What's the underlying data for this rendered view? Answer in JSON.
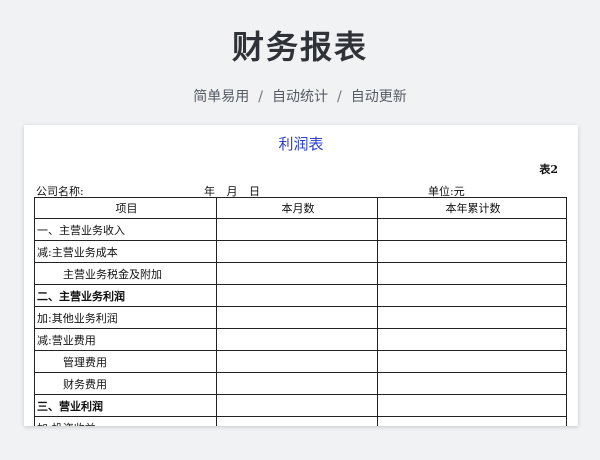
{
  "page": {
    "title": "财务报表",
    "tags": [
      "简单易用",
      "自动统计",
      "自动更新"
    ],
    "separator": "/"
  },
  "sheet": {
    "title": "利润表",
    "table_no": "表2",
    "company_label": "公司名称:",
    "date_label": "年 月 日",
    "unit_label": "单位:元",
    "headers": [
      "项目",
      "本月数",
      "本年累计数"
    ],
    "rows": [
      {
        "label": "一、主营业务收入",
        "bold": false,
        "indent": false
      },
      {
        "label": "减:主营业务成本",
        "bold": false,
        "indent": false
      },
      {
        "label": "主营业务税金及附加",
        "bold": false,
        "indent": true
      },
      {
        "label": "二、主营业务利润",
        "bold": true,
        "indent": false
      },
      {
        "label": "加:其他业务利润",
        "bold": false,
        "indent": false
      },
      {
        "label": "减:营业费用",
        "bold": false,
        "indent": false
      },
      {
        "label": "管理费用",
        "bold": false,
        "indent": true
      },
      {
        "label": "财务费用",
        "bold": false,
        "indent": true
      },
      {
        "label": "三、营业利润",
        "bold": true,
        "indent": false
      },
      {
        "label": "加:投资收益",
        "bold": false,
        "indent": false
      }
    ]
  }
}
